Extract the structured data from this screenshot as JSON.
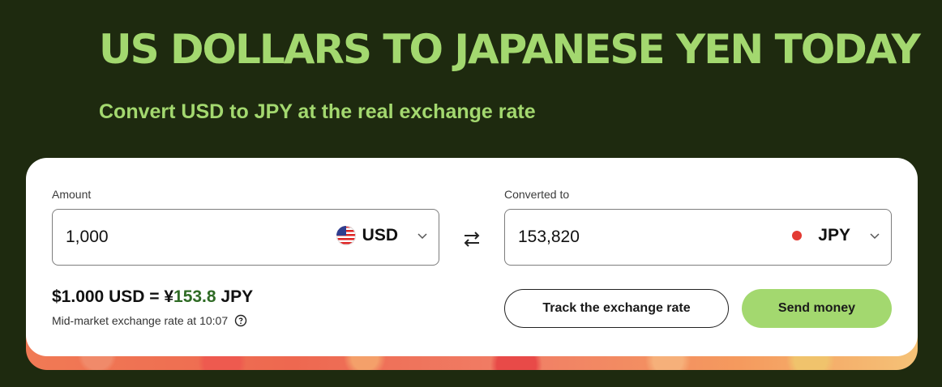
{
  "hero": {
    "title": "US DOLLARS TO JAPANESE YEN TODAY",
    "subtitle": "Convert USD to JPY at the real exchange rate"
  },
  "converter": {
    "amount_label": "Amount",
    "amount_value": "1,000",
    "from_currency": "USD",
    "converted_label": "Converted to",
    "converted_value": "153,820",
    "to_currency": "JPY"
  },
  "rate": {
    "prefix": "$1.000 USD = ¥",
    "value": "153.8",
    "suffix": " JPY",
    "note": "Mid-market exchange rate at 10:07"
  },
  "actions": {
    "track_label": "Track the exchange rate",
    "send_label": "Send money"
  },
  "colors": {
    "background": "#1e2a0f",
    "accent": "#a3d86f",
    "rate_green": "#2f6b25"
  },
  "icons": [
    "us-flag-icon",
    "jp-flag-icon",
    "chevron-down-icon",
    "swap-icon",
    "help-icon"
  ]
}
